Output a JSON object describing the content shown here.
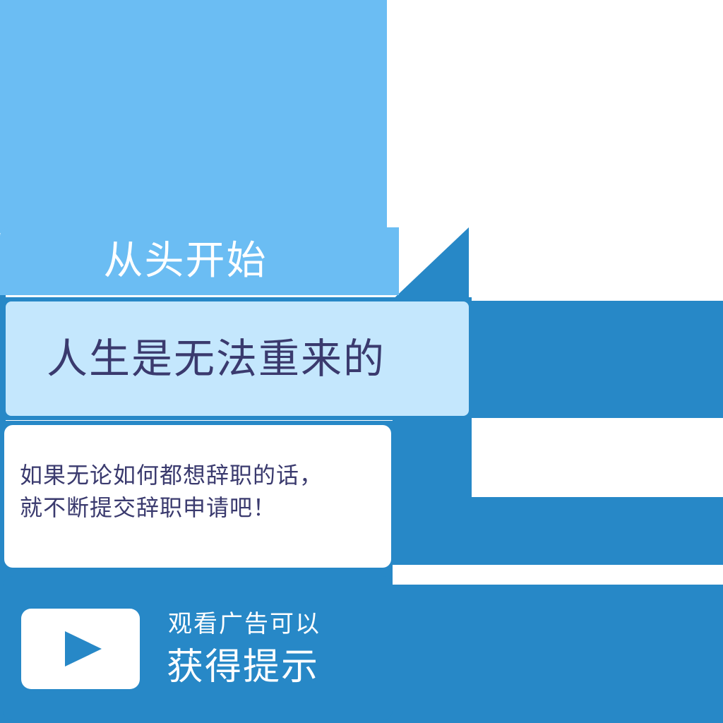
{
  "restart_button": {
    "label": "从头开始"
  },
  "title": {
    "text": "人生是无法重来的"
  },
  "message": {
    "line1": "如果无论如何都想辞职的话，",
    "line2": "就不断提交辞职申请吧！"
  },
  "ad_hint_button": {
    "line1": "观看广告可以",
    "line2": "获得提示",
    "icon": "play-icon"
  },
  "colors": {
    "light_blue": "#6bbdf3",
    "pale_blue": "#c4e7fd",
    "dark_blue": "#2788c7",
    "text_dark": "#3a3a6e",
    "white": "#ffffff"
  }
}
